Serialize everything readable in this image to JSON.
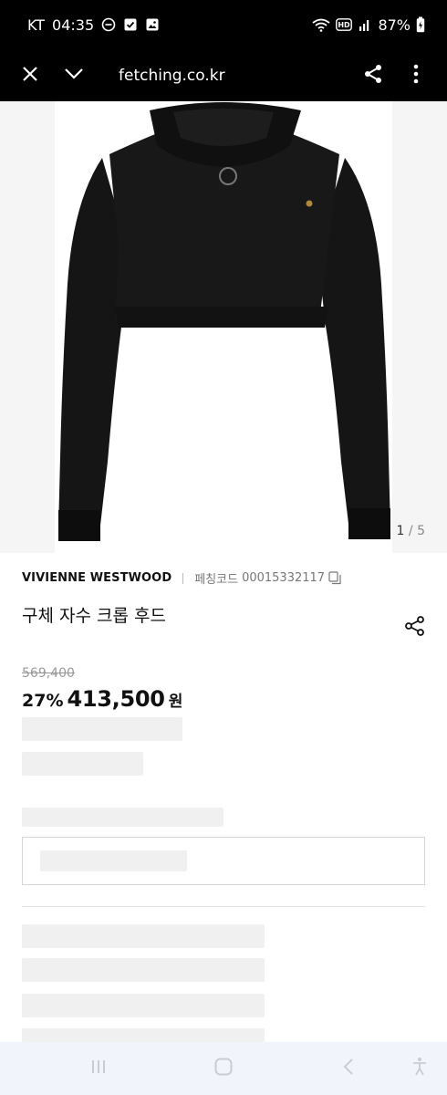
{
  "status_bar": {
    "carrier": "KT",
    "time": "04:35",
    "battery": "87%",
    "icons": [
      "do-not-disturb-icon",
      "checkbox-icon",
      "gallery-icon",
      "wifi-icon",
      "hd-icon",
      "signal-icon",
      "battery-icon"
    ]
  },
  "browser": {
    "url": "fetching.co.kr",
    "icons": [
      "close-icon",
      "chevron-down-icon",
      "share-icon",
      "more-vertical-icon"
    ]
  },
  "gallery": {
    "current": "1",
    "separator": "/",
    "total": "5"
  },
  "product": {
    "brand": "VIVIENNE WESTWOOD",
    "code_label": "페칭코드",
    "code": "00015332117",
    "title": "구체 자수 크롭 후드",
    "original_price": "569,400",
    "discount": "27%",
    "sale_price": "413,500",
    "currency": "원"
  },
  "nav_bar": {
    "icons": [
      "recent-apps-icon",
      "home-icon",
      "back-icon",
      "accessibility-icon"
    ]
  },
  "colors": {
    "status_bg": "#000000",
    "skeleton": "#f0f0f0",
    "nav_bg": "#f2f4fb"
  }
}
